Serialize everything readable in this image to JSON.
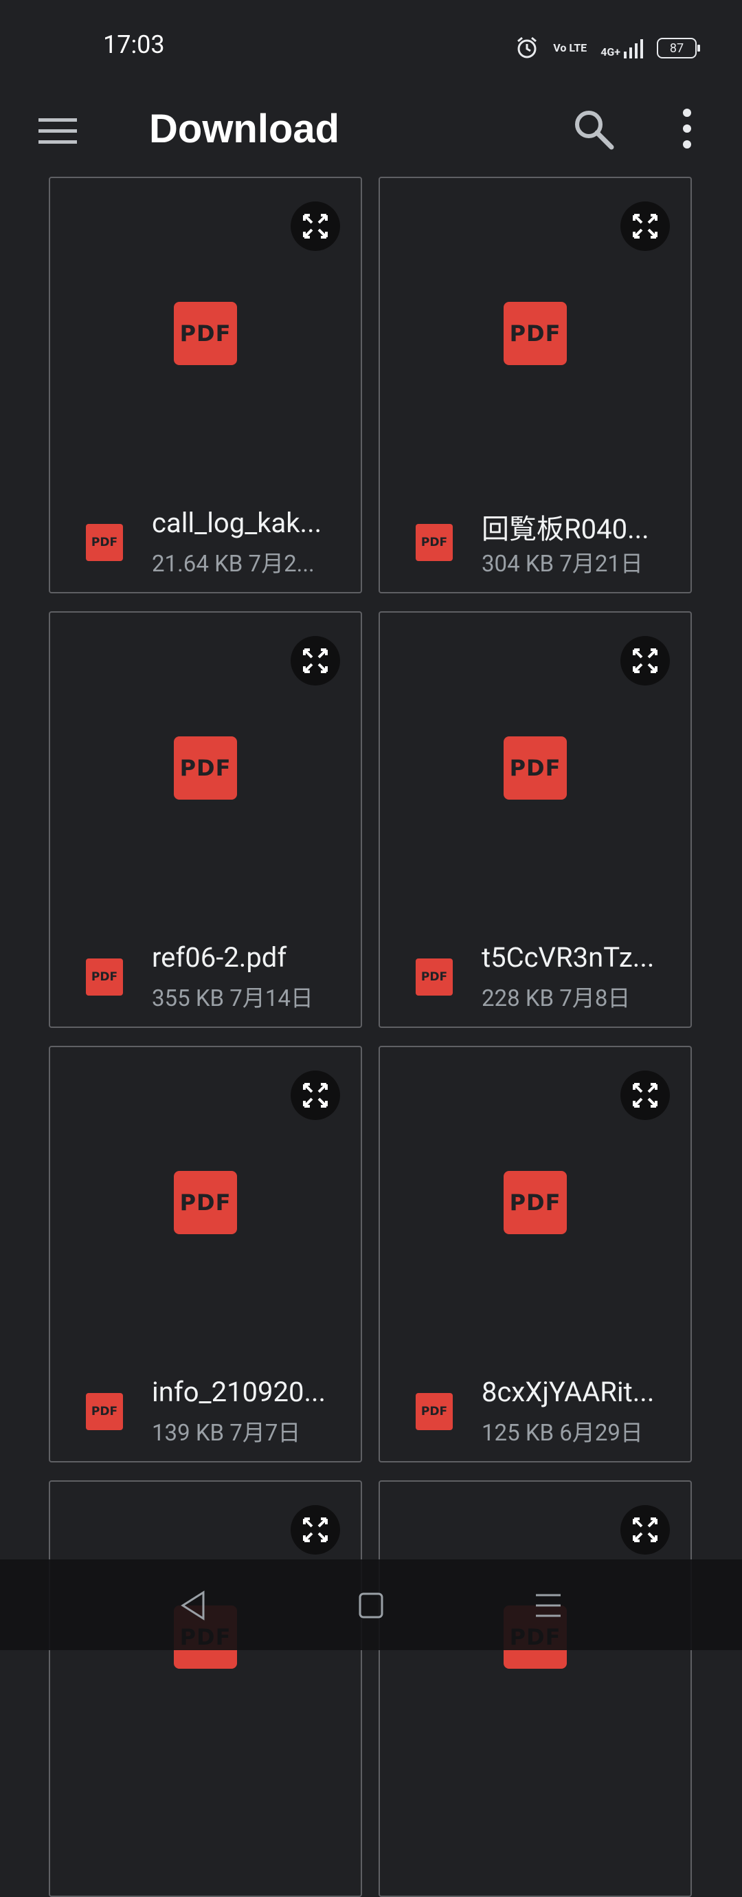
{
  "status_bar": {
    "time": "17:03",
    "battery": "87",
    "network": "4G+",
    "volte": "Vo LTE"
  },
  "app_bar": {
    "title": "Download"
  },
  "files": [
    {
      "name": "call_log_kak...",
      "meta": "21.64 KB 7月2...",
      "badge": "PDF"
    },
    {
      "name": "回覧板R040...",
      "meta": "304 KB 7月21日",
      "badge": "PDF"
    },
    {
      "name": "ref06-2.pdf",
      "meta": "355 KB 7月14日",
      "badge": "PDF"
    },
    {
      "name": "t5CcVR3nTz...",
      "meta": "228 KB 7月8日",
      "badge": "PDF"
    },
    {
      "name": "info_210920...",
      "meta": "139 KB 7月7日",
      "badge": "PDF"
    },
    {
      "name": "8cxXjYAARit...",
      "meta": "125 KB 6月29日",
      "badge": "PDF"
    },
    {
      "name": "",
      "meta": "",
      "badge": "PDF"
    },
    {
      "name": "",
      "meta": "",
      "badge": "PDF"
    }
  ],
  "icons": {
    "menu": "hamburger-menu-icon",
    "search": "search-icon",
    "more": "more-vert-icon",
    "expand": "expand-icon",
    "nav_back": "back-triangle-icon",
    "nav_home": "home-square-icon",
    "nav_recents": "recents-lines-icon"
  },
  "colors": {
    "background": "#202124",
    "pdf_red": "#e0433a",
    "card_border": "#5f6064",
    "secondary_text": "#9aa0a6"
  }
}
